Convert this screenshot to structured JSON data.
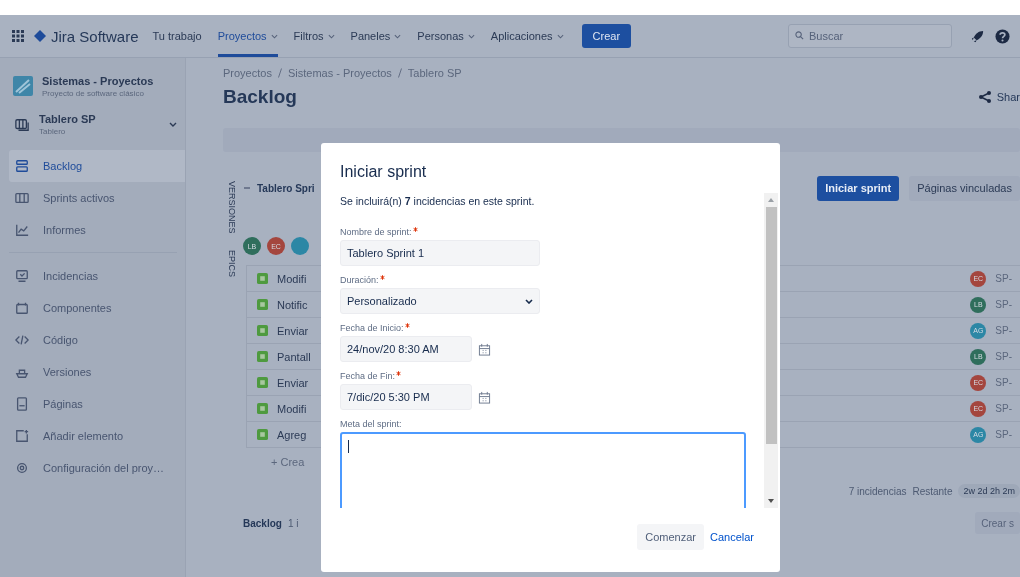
{
  "nav": {
    "product": "Jira Software",
    "items": [
      {
        "label": "Tu trabajo",
        "selected": false,
        "menu": false
      },
      {
        "label": "Proyectos",
        "selected": true,
        "menu": true
      },
      {
        "label": "Filtros",
        "selected": false,
        "menu": true
      },
      {
        "label": "Paneles",
        "selected": false,
        "menu": true
      },
      {
        "label": "Personas",
        "selected": false,
        "menu": true
      },
      {
        "label": "Aplicaciones",
        "selected": false,
        "menu": true
      }
    ],
    "create": "Crear",
    "search": {
      "placeholder": "Buscar"
    }
  },
  "sidebar": {
    "project": {
      "name": "Sistemas - Proyectos",
      "subtitle": "Proyecto de software clásico"
    },
    "board": {
      "name": "Tablero SP",
      "subtitle": "Tablero"
    },
    "groups": [
      {
        "items": [
          {
            "label": "Backlog",
            "selected": true
          },
          {
            "label": "Sprints activos",
            "selected": false
          },
          {
            "label": "Informes",
            "selected": false
          }
        ]
      },
      {
        "items": [
          {
            "label": "Incidencias",
            "selected": false
          },
          {
            "label": "Componentes",
            "selected": false
          },
          {
            "label": "Código",
            "selected": false
          },
          {
            "label": "Versiones",
            "selected": false
          },
          {
            "label": "Páginas",
            "selected": false
          },
          {
            "label": "Añadir elemento",
            "selected": false
          },
          {
            "label": "Configuración del proy…",
            "selected": false
          }
        ]
      }
    ]
  },
  "main": {
    "breadcrumbs": [
      "Proyectos",
      "Sistemas - Proyectos",
      "Tablero SP"
    ],
    "title": "Backlog",
    "share": "Shar",
    "side_tabs": [
      "VERSIONES",
      "EPICS"
    ],
    "sprint": {
      "name": "Tablero Spri",
      "start_button": "Iniciar sprint",
      "linked_pages": "Páginas vinculadas",
      "avatars": [
        {
          "initials": "LB",
          "color": "#2f6e5c"
        },
        {
          "initials": "EC",
          "color": "#a4463e"
        },
        {
          "color": "#2c87a5"
        }
      ],
      "issues": [
        {
          "summary": "Modifi",
          "assignee": "EC",
          "color": "#a4463e",
          "key": "SP-"
        },
        {
          "summary": "Notific",
          "assignee": "LB",
          "color": "#2f6e5c",
          "key": "SP-"
        },
        {
          "summary": "Enviar",
          "assignee": "AG",
          "color": "#2c87a5",
          "key": "SP-"
        },
        {
          "summary": "Pantall",
          "assignee": "LB",
          "color": "#2f6e5c",
          "key": "SP-"
        },
        {
          "summary": "Enviar",
          "assignee": "EC",
          "color": "#a4463e",
          "key": "SP-"
        },
        {
          "summary": "Modifi",
          "assignee": "EC",
          "color": "#a4463e",
          "key": "SP-"
        },
        {
          "summary": "Agreg",
          "assignee": "AG",
          "color": "#2c87a5",
          "key": "SP-"
        }
      ],
      "create_issue": "+ Crea",
      "count": "7 incidencias",
      "remaining_label": "Restante",
      "remaining": "2w 2d 2h 2m"
    },
    "backlog": {
      "title": "Backlog",
      "count": "1 i",
      "create_sprint": "Crear s"
    }
  },
  "dialog": {
    "title": "Iniciar sprint",
    "intro": "Se incluirá(n) **7** incidencias en este sprint.",
    "fields": [
      {
        "kind": "text",
        "label": "Nombre de sprint:",
        "required": true,
        "value": "Tablero Sprint 1"
      },
      {
        "kind": "select",
        "label": "Duración:",
        "required": true,
        "value": "Personalizado"
      },
      {
        "kind": "date",
        "label": "Fecha de Inicio:",
        "required": true,
        "value": "24/nov/20 8:30 AM"
      },
      {
        "kind": "date",
        "label": "Fecha de Fin:",
        "required": true,
        "value": "7/dic/20 5:30 PM"
      },
      {
        "kind": "textarea",
        "label": "Meta del sprint:",
        "required": false,
        "focused": true
      }
    ],
    "buttons": [
      {
        "label": "Comenzar",
        "kind": "secondary"
      },
      {
        "label": "Cancelar",
        "kind": "link"
      }
    ]
  }
}
